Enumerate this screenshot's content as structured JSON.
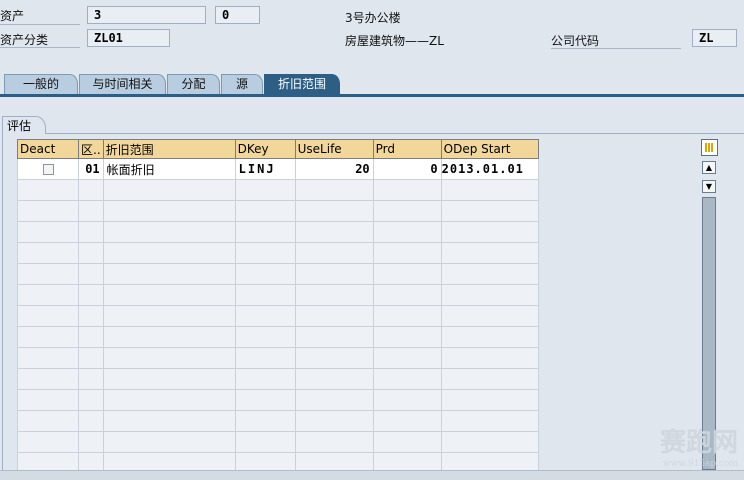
{
  "header": {
    "asset_label": "资产",
    "asset_value": "3",
    "subnumber_value": "0",
    "asset_description": "3号办公楼",
    "asset_class_label": "资产分类",
    "asset_class_value": "ZL01",
    "asset_class_description": "房屋建筑物——ZL",
    "company_code_label": "公司代码",
    "company_code_value": "ZL"
  },
  "tabs": [
    "一般的",
    "与时间相关",
    "分配",
    "源",
    "折旧范围"
  ],
  "active_tab": "折旧范围",
  "group": {
    "title": "评估"
  },
  "table": {
    "columns": [
      "Deact",
      "区..",
      "折旧范围",
      "DKey",
      "UseLife",
      "Prd",
      "ODep Start"
    ],
    "rows": [
      {
        "deact": false,
        "area": "01",
        "area_name": "帐面折旧",
        "dkey": "LINJ",
        "use_life": "20",
        "prd": "0",
        "odep_start": "2013.01.01"
      }
    ]
  },
  "watermark": {
    "text": "赛跑网",
    "url": "www.915ap.com"
  },
  "icons": {
    "config": "table-config-icon",
    "up": "scroll-up-icon",
    "down": "scroll-down-icon"
  },
  "colors": {
    "tab_active": "#2d5f86",
    "tab_inactive": "#b9cde0",
    "header_cell": "#f2d79a"
  }
}
